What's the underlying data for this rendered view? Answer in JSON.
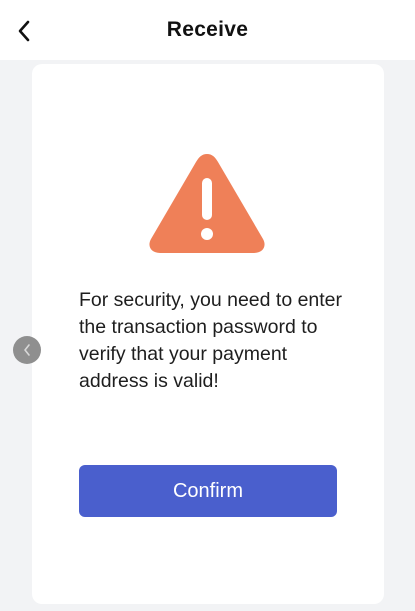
{
  "header": {
    "title": "Receive",
    "back_icon": "chevron-left-icon"
  },
  "dialog": {
    "icon": "warning-triangle-icon",
    "icon_color": "#ef8058",
    "message": "For security, you need to enter the transaction password to verify that your payment address is valid!",
    "confirm_label": "Confirm",
    "confirm_color": "#4a5fcd"
  },
  "side_handle": {
    "icon": "chevron-left-icon"
  }
}
